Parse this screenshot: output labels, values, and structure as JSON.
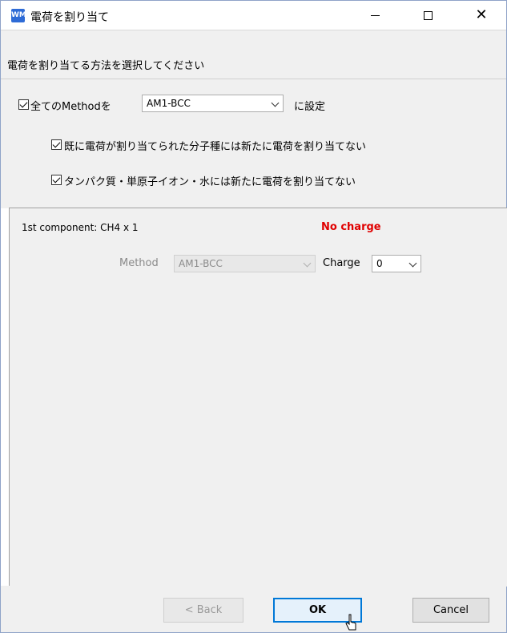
{
  "window": {
    "title": "電荷を割り当て",
    "app_icon_text": "WM"
  },
  "instruction": "電荷を割り当てる方法を選択してください",
  "options": {
    "all_methods_label": "全てのMethodを",
    "all_methods_value": "AM1-BCC",
    "set_suffix": "に設定",
    "skip_assigned_label": "既に電荷が割り当てられた分子種には新たに電荷を割り当てない",
    "skip_protein_label": "タンパク質・単原子イオン・水には新たに電荷を割り当てない"
  },
  "component": {
    "label": "1st component: CH4 x 1",
    "status": "No charge",
    "method_label": "Method",
    "method_value": "AM1-BCC",
    "charge_label": "Charge",
    "charge_value": "0"
  },
  "buttons": {
    "back": "< Back",
    "ok": "OK",
    "cancel": "Cancel"
  },
  "colors": {
    "accent": "#0078d7",
    "no_charge": "#e00000",
    "panel_bg": "#f0f0f0"
  }
}
